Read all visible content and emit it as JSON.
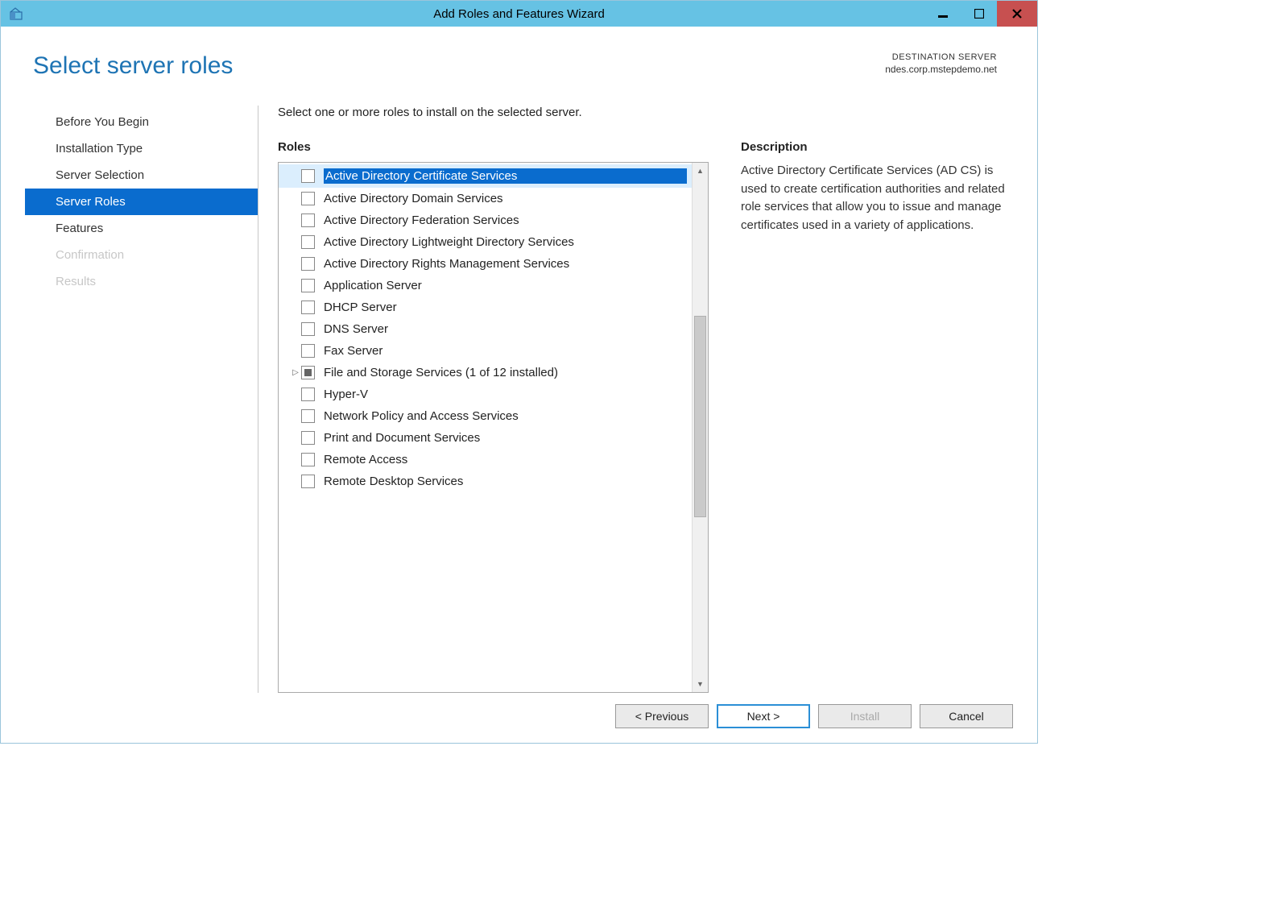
{
  "titlebar": {
    "title": "Add Roles and Features Wizard"
  },
  "header": {
    "page_title": "Select server roles",
    "dest_label": "DESTINATION SERVER",
    "dest_server": "ndes.corp.mstepdemo.net"
  },
  "sidebar": {
    "items": [
      {
        "label": "Before You Begin",
        "active": false,
        "disabled": false
      },
      {
        "label": "Installation Type",
        "active": false,
        "disabled": false
      },
      {
        "label": "Server Selection",
        "active": false,
        "disabled": false
      },
      {
        "label": "Server Roles",
        "active": true,
        "disabled": false
      },
      {
        "label": "Features",
        "active": false,
        "disabled": false
      },
      {
        "label": "Confirmation",
        "active": false,
        "disabled": true
      },
      {
        "label": "Results",
        "active": false,
        "disabled": true
      }
    ]
  },
  "main": {
    "instructions": "Select one or more roles to install on the selected server.",
    "roles_heading": "Roles",
    "desc_heading": "Description",
    "description": "Active Directory Certificate Services (AD CS) is used to create certification authorities and related role services that allow you to issue and manage certificates used in a variety of applications.",
    "roles": [
      {
        "label": "Active Directory Certificate Services",
        "checked": "none",
        "selected": true,
        "expand": false
      },
      {
        "label": "Active Directory Domain Services",
        "checked": "none",
        "selected": false,
        "expand": false
      },
      {
        "label": "Active Directory Federation Services",
        "checked": "none",
        "selected": false,
        "expand": false
      },
      {
        "label": "Active Directory Lightweight Directory Services",
        "checked": "none",
        "selected": false,
        "expand": false
      },
      {
        "label": "Active Directory Rights Management Services",
        "checked": "none",
        "selected": false,
        "expand": false
      },
      {
        "label": "Application Server",
        "checked": "none",
        "selected": false,
        "expand": false
      },
      {
        "label": "DHCP Server",
        "checked": "none",
        "selected": false,
        "expand": false
      },
      {
        "label": "DNS Server",
        "checked": "none",
        "selected": false,
        "expand": false
      },
      {
        "label": "Fax Server",
        "checked": "none",
        "selected": false,
        "expand": false
      },
      {
        "label": "File and Storage Services (1 of 12 installed)",
        "checked": "partial",
        "selected": false,
        "expand": true
      },
      {
        "label": "Hyper-V",
        "checked": "none",
        "selected": false,
        "expand": false
      },
      {
        "label": "Network Policy and Access Services",
        "checked": "none",
        "selected": false,
        "expand": false
      },
      {
        "label": "Print and Document Services",
        "checked": "none",
        "selected": false,
        "expand": false
      },
      {
        "label": "Remote Access",
        "checked": "none",
        "selected": false,
        "expand": false
      },
      {
        "label": "Remote Desktop Services",
        "checked": "none",
        "selected": false,
        "expand": false
      }
    ]
  },
  "buttons": {
    "previous": "< Previous",
    "next": "Next >",
    "install": "Install",
    "cancel": "Cancel"
  }
}
